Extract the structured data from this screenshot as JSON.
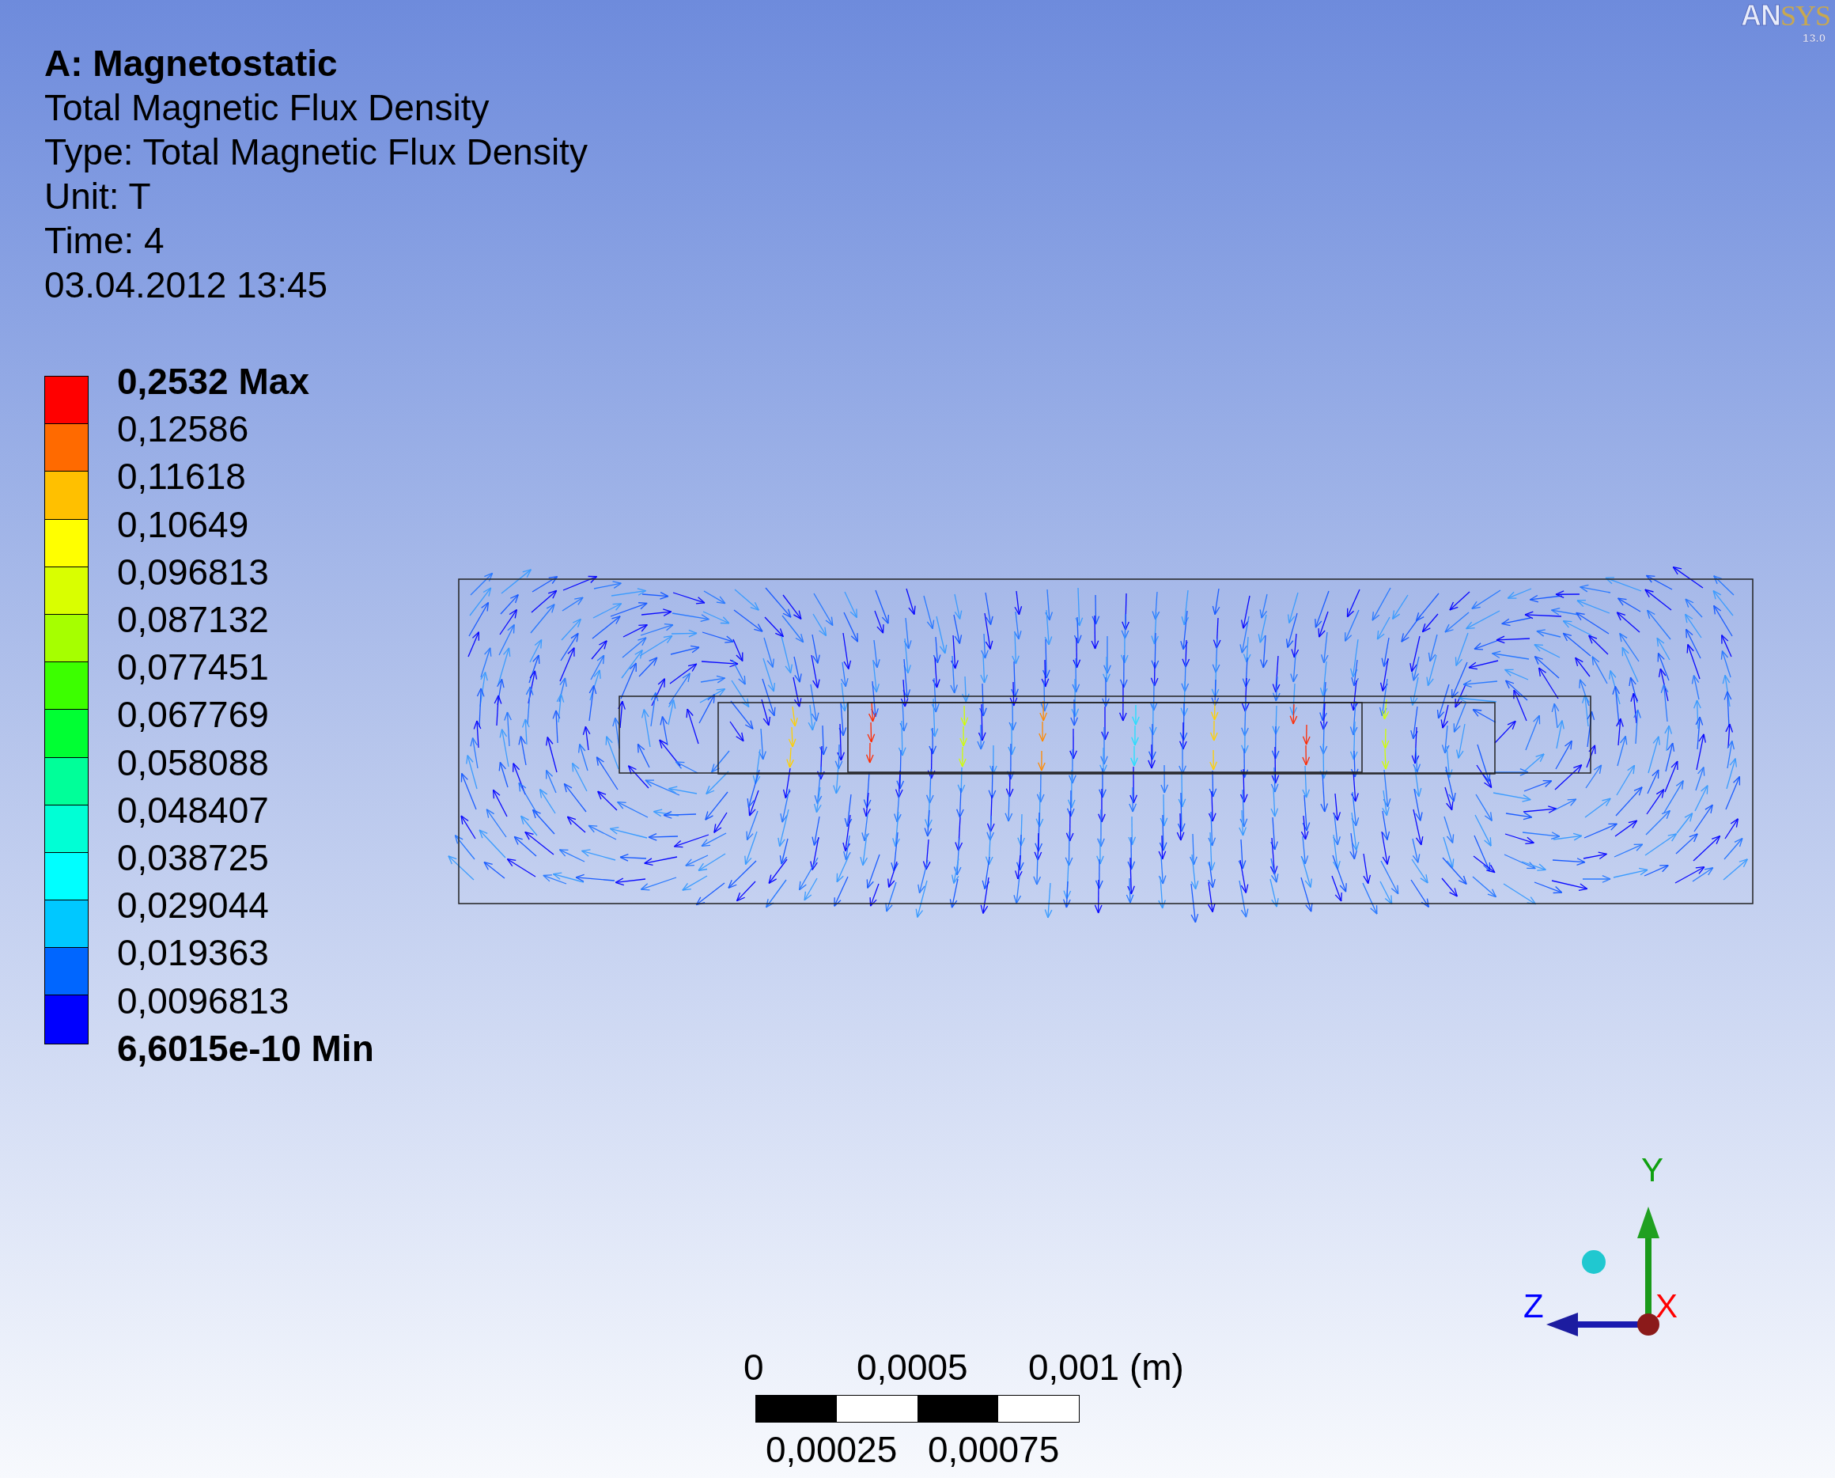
{
  "header": {
    "title": "A: Magnetostatic",
    "lines": [
      "Total Magnetic Flux Density",
      "Type: Total Magnetic Flux Density",
      "Unit: T",
      "Time: 4",
      "03.04.2012 13:45"
    ]
  },
  "legend": {
    "bands": [
      {
        "color": "#ff0000"
      },
      {
        "color": "#ff6a00"
      },
      {
        "color": "#ffc000"
      },
      {
        "color": "#ffff00"
      },
      {
        "color": "#d9ff00"
      },
      {
        "color": "#a6ff00"
      },
      {
        "color": "#3cff00"
      },
      {
        "color": "#00ff33"
      },
      {
        "color": "#00ff99"
      },
      {
        "color": "#00ffd5"
      },
      {
        "color": "#00ffff"
      },
      {
        "color": "#00c8ff"
      },
      {
        "color": "#0066ff"
      },
      {
        "color": "#0000ff"
      }
    ],
    "labels": [
      {
        "text": "0,2532 Max",
        "kind": "max"
      },
      {
        "text": "0,12586",
        "kind": "value"
      },
      {
        "text": "0,11618",
        "kind": "value"
      },
      {
        "text": "0,10649",
        "kind": "value"
      },
      {
        "text": "0,096813",
        "kind": "value"
      },
      {
        "text": "0,087132",
        "kind": "value"
      },
      {
        "text": "0,077451",
        "kind": "value"
      },
      {
        "text": "0,067769",
        "kind": "value"
      },
      {
        "text": "0,058088",
        "kind": "value"
      },
      {
        "text": "0,048407",
        "kind": "value"
      },
      {
        "text": "0,038725",
        "kind": "value"
      },
      {
        "text": "0,029044",
        "kind": "value"
      },
      {
        "text": "0,019363",
        "kind": "value"
      },
      {
        "text": "0,0096813",
        "kind": "value"
      },
      {
        "text": "6,6015e-10 Min",
        "kind": "min"
      }
    ]
  },
  "logo": {
    "parts": [
      "AN",
      "SYS"
    ],
    "version": "13.0"
  },
  "scale_bar": {
    "top_labels": [
      "0",
      "0,0005",
      "0,001 (m)"
    ],
    "bottom_labels": [
      "0,00025",
      "0,00075"
    ]
  },
  "triad": {
    "labels": [
      "Y",
      "Z",
      "X"
    ]
  }
}
